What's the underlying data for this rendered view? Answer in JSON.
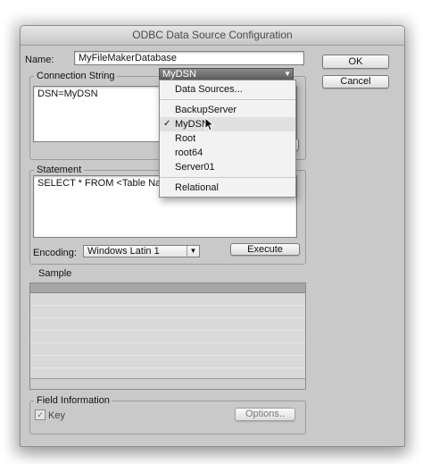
{
  "window": {
    "title": "ODBC Data Source Configuration"
  },
  "name_field": {
    "label": "Name:",
    "value": "MyFileMakerDatabase"
  },
  "buttons": {
    "ok": "OK",
    "cancel": "Cancel",
    "execute": "Execute",
    "options": "Options.."
  },
  "connection": {
    "group_title": "Connection String",
    "text": "DSN=MyDSN",
    "popup_value": "MyDSN"
  },
  "dsn_menu": {
    "items": [
      {
        "label": "Data Sources...",
        "checked": false
      },
      {
        "label": "BackupServer",
        "checked": false
      },
      {
        "label": "MyDSN",
        "checked": true
      },
      {
        "label": "Root",
        "checked": false
      },
      {
        "label": "root64",
        "checked": false
      },
      {
        "label": "Server01",
        "checked": false
      },
      {
        "label": "Relational",
        "checked": false
      }
    ],
    "check_glyph": "✓"
  },
  "statement": {
    "group_title": "Statement",
    "text": "SELECT * FROM <Table Name>"
  },
  "encoding": {
    "label": "Encoding:",
    "value": "Windows Latin 1"
  },
  "sample": {
    "title": "Sample"
  },
  "field_info": {
    "group_title": "Field Information",
    "key_label": "Key",
    "key_checked": true,
    "check_glyph": "✓"
  },
  "icons": {
    "dropdown": "chevron-down-icon",
    "cursor": "mouse-pointer-icon"
  },
  "colors": {
    "popup_active": "#6f6f6f",
    "window_bg": "#c9c9c9"
  }
}
